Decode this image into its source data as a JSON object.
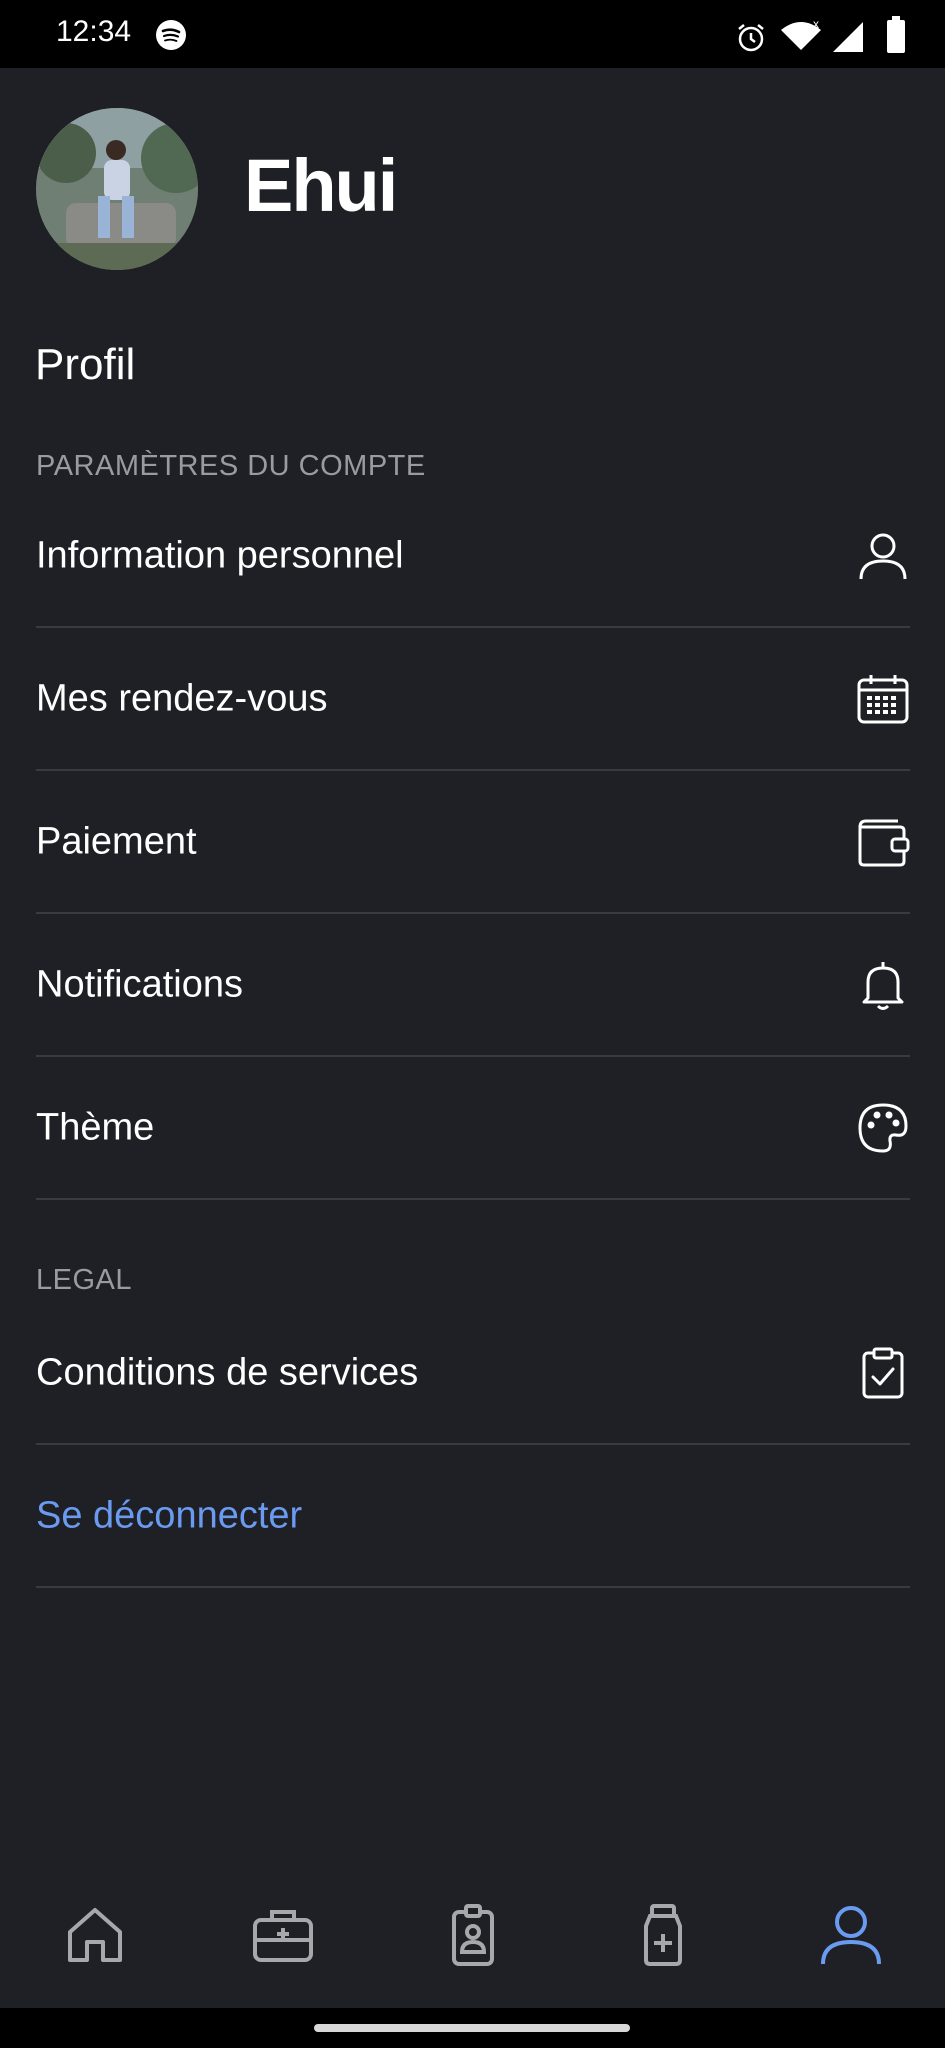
{
  "status_bar": {
    "time": "12:34",
    "icons": [
      "spotify-icon",
      "alarm-icon",
      "wifi-icon",
      "signal-icon",
      "battery-icon"
    ]
  },
  "profile": {
    "name": "Ehui",
    "avatar": "avatar-photo"
  },
  "page_title": "Profil",
  "sections": {
    "account": {
      "label": "PARAMÈTRES DU COMPTE",
      "items": [
        {
          "label": "Information personnel",
          "icon": "user-icon"
        },
        {
          "label": "Mes rendez-vous",
          "icon": "calendar-icon"
        },
        {
          "label": "Paiement",
          "icon": "wallet-icon"
        },
        {
          "label": "Notifications",
          "icon": "bell-icon"
        },
        {
          "label": "Thème",
          "icon": "palette-icon"
        }
      ]
    },
    "legal": {
      "label": "LEGAL",
      "items": [
        {
          "label": "Conditions de services",
          "icon": "clipboard-check-icon"
        }
      ]
    }
  },
  "logout_label": "Se déconnecter",
  "bottom_nav": {
    "items": [
      {
        "name": "home",
        "icon": "home-icon",
        "active": false
      },
      {
        "name": "medical-kit",
        "icon": "medical-kit-icon",
        "active": false
      },
      {
        "name": "badge",
        "icon": "id-badge-icon",
        "active": false
      },
      {
        "name": "medicine",
        "icon": "medicine-bottle-icon",
        "active": false
      },
      {
        "name": "profile",
        "icon": "user-icon",
        "active": true
      }
    ]
  },
  "colors": {
    "background": "#1f2025",
    "accent": "#6a9bf0",
    "divider": "#3a3b40",
    "muted_text": "#9a9ba0"
  }
}
